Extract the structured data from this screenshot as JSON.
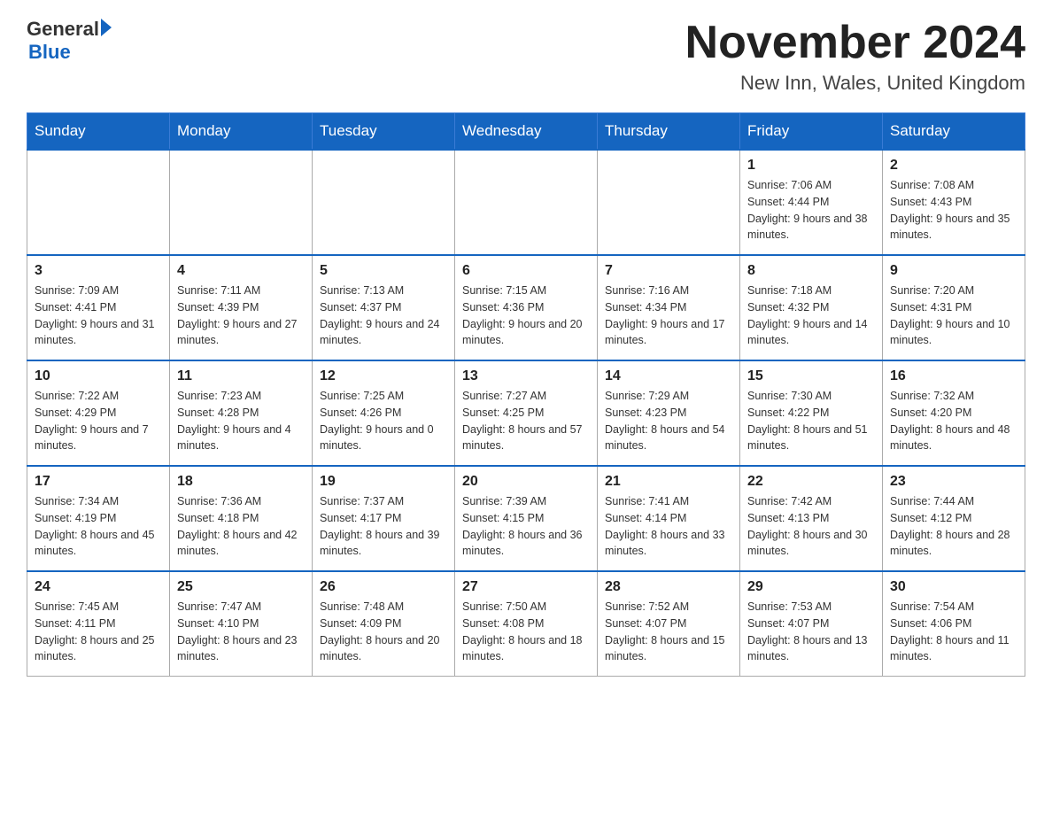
{
  "logo": {
    "general": "General",
    "blue": "Blue"
  },
  "title": {
    "month_year": "November 2024",
    "location": "New Inn, Wales, United Kingdom"
  },
  "weekdays": [
    "Sunday",
    "Monday",
    "Tuesday",
    "Wednesday",
    "Thursday",
    "Friday",
    "Saturday"
  ],
  "weeks": [
    [
      {
        "day": "",
        "info": ""
      },
      {
        "day": "",
        "info": ""
      },
      {
        "day": "",
        "info": ""
      },
      {
        "day": "",
        "info": ""
      },
      {
        "day": "",
        "info": ""
      },
      {
        "day": "1",
        "info": "Sunrise: 7:06 AM\nSunset: 4:44 PM\nDaylight: 9 hours and 38 minutes."
      },
      {
        "day": "2",
        "info": "Sunrise: 7:08 AM\nSunset: 4:43 PM\nDaylight: 9 hours and 35 minutes."
      }
    ],
    [
      {
        "day": "3",
        "info": "Sunrise: 7:09 AM\nSunset: 4:41 PM\nDaylight: 9 hours and 31 minutes."
      },
      {
        "day": "4",
        "info": "Sunrise: 7:11 AM\nSunset: 4:39 PM\nDaylight: 9 hours and 27 minutes."
      },
      {
        "day": "5",
        "info": "Sunrise: 7:13 AM\nSunset: 4:37 PM\nDaylight: 9 hours and 24 minutes."
      },
      {
        "day": "6",
        "info": "Sunrise: 7:15 AM\nSunset: 4:36 PM\nDaylight: 9 hours and 20 minutes."
      },
      {
        "day": "7",
        "info": "Sunrise: 7:16 AM\nSunset: 4:34 PM\nDaylight: 9 hours and 17 minutes."
      },
      {
        "day": "8",
        "info": "Sunrise: 7:18 AM\nSunset: 4:32 PM\nDaylight: 9 hours and 14 minutes."
      },
      {
        "day": "9",
        "info": "Sunrise: 7:20 AM\nSunset: 4:31 PM\nDaylight: 9 hours and 10 minutes."
      }
    ],
    [
      {
        "day": "10",
        "info": "Sunrise: 7:22 AM\nSunset: 4:29 PM\nDaylight: 9 hours and 7 minutes."
      },
      {
        "day": "11",
        "info": "Sunrise: 7:23 AM\nSunset: 4:28 PM\nDaylight: 9 hours and 4 minutes."
      },
      {
        "day": "12",
        "info": "Sunrise: 7:25 AM\nSunset: 4:26 PM\nDaylight: 9 hours and 0 minutes."
      },
      {
        "day": "13",
        "info": "Sunrise: 7:27 AM\nSunset: 4:25 PM\nDaylight: 8 hours and 57 minutes."
      },
      {
        "day": "14",
        "info": "Sunrise: 7:29 AM\nSunset: 4:23 PM\nDaylight: 8 hours and 54 minutes."
      },
      {
        "day": "15",
        "info": "Sunrise: 7:30 AM\nSunset: 4:22 PM\nDaylight: 8 hours and 51 minutes."
      },
      {
        "day": "16",
        "info": "Sunrise: 7:32 AM\nSunset: 4:20 PM\nDaylight: 8 hours and 48 minutes."
      }
    ],
    [
      {
        "day": "17",
        "info": "Sunrise: 7:34 AM\nSunset: 4:19 PM\nDaylight: 8 hours and 45 minutes."
      },
      {
        "day": "18",
        "info": "Sunrise: 7:36 AM\nSunset: 4:18 PM\nDaylight: 8 hours and 42 minutes."
      },
      {
        "day": "19",
        "info": "Sunrise: 7:37 AM\nSunset: 4:17 PM\nDaylight: 8 hours and 39 minutes."
      },
      {
        "day": "20",
        "info": "Sunrise: 7:39 AM\nSunset: 4:15 PM\nDaylight: 8 hours and 36 minutes."
      },
      {
        "day": "21",
        "info": "Sunrise: 7:41 AM\nSunset: 4:14 PM\nDaylight: 8 hours and 33 minutes."
      },
      {
        "day": "22",
        "info": "Sunrise: 7:42 AM\nSunset: 4:13 PM\nDaylight: 8 hours and 30 minutes."
      },
      {
        "day": "23",
        "info": "Sunrise: 7:44 AM\nSunset: 4:12 PM\nDaylight: 8 hours and 28 minutes."
      }
    ],
    [
      {
        "day": "24",
        "info": "Sunrise: 7:45 AM\nSunset: 4:11 PM\nDaylight: 8 hours and 25 minutes."
      },
      {
        "day": "25",
        "info": "Sunrise: 7:47 AM\nSunset: 4:10 PM\nDaylight: 8 hours and 23 minutes."
      },
      {
        "day": "26",
        "info": "Sunrise: 7:48 AM\nSunset: 4:09 PM\nDaylight: 8 hours and 20 minutes."
      },
      {
        "day": "27",
        "info": "Sunrise: 7:50 AM\nSunset: 4:08 PM\nDaylight: 8 hours and 18 minutes."
      },
      {
        "day": "28",
        "info": "Sunrise: 7:52 AM\nSunset: 4:07 PM\nDaylight: 8 hours and 15 minutes."
      },
      {
        "day": "29",
        "info": "Sunrise: 7:53 AM\nSunset: 4:07 PM\nDaylight: 8 hours and 13 minutes."
      },
      {
        "day": "30",
        "info": "Sunrise: 7:54 AM\nSunset: 4:06 PM\nDaylight: 8 hours and 11 minutes."
      }
    ]
  ]
}
